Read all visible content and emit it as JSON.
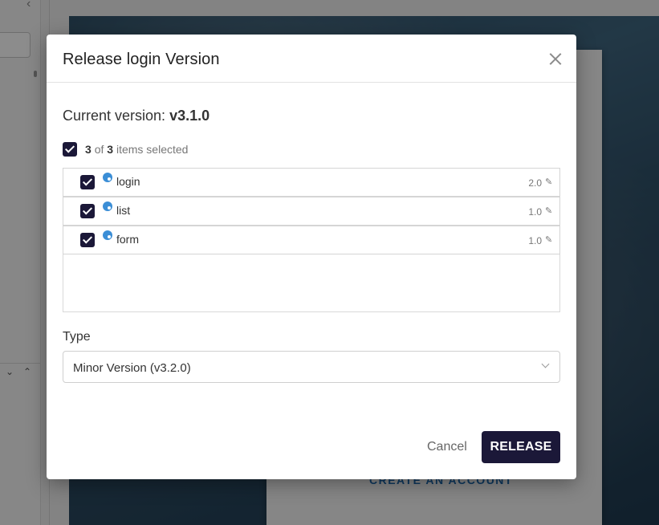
{
  "background": {
    "create_account_link": "CREATE AN ACCOUNT"
  },
  "modal": {
    "title": "Release login Version",
    "current_version_label": "Current version:",
    "current_version_value": "v3.1.0",
    "selection": {
      "selected": "3",
      "of_text": "of",
      "total": "3",
      "suffix": "items selected",
      "all_checked": true
    },
    "items": [
      {
        "name": "login",
        "version": "2.0",
        "checked": true,
        "icon": "palette-icon"
      },
      {
        "name": "list",
        "version": "1.0",
        "checked": true,
        "icon": "palette-icon"
      },
      {
        "name": "form",
        "version": "1.0",
        "checked": true,
        "icon": "palette-icon"
      }
    ],
    "type_label": "Type",
    "type_value": "Minor Version (v3.2.0)",
    "cancel_label": "Cancel",
    "release_label": "RELEASE"
  },
  "colors": {
    "primary": "#1b1838",
    "icon_blue": "#3b8ed6"
  }
}
